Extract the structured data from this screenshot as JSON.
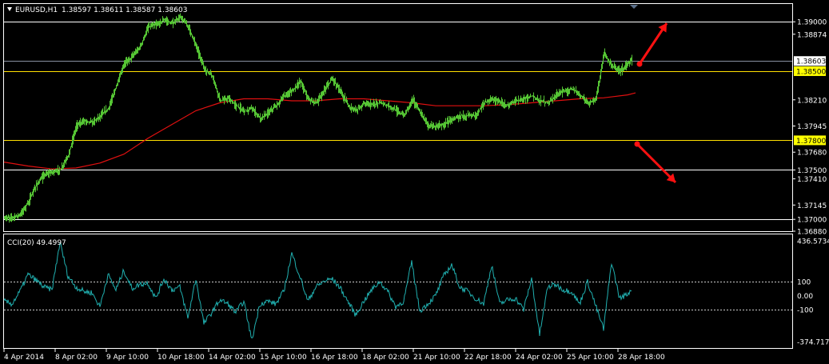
{
  "header": {
    "symbol_label": "EURUSD,H1",
    "ohlc_label": "1.38597 1.38611 1.38587 1.38603",
    "menu_icon": "triangle-down-icon"
  },
  "colors": {
    "background": "#000000",
    "candles": "#55c434",
    "moving_average": "#e01010",
    "cci": "#20b0b0",
    "level_white": "#ffffff",
    "level_yellow": "#ffe000",
    "price_tag_bg": "#ffffff",
    "highlight_tag_bg": "#ffff00",
    "arrows": "#ff1111"
  },
  "chart_data": [
    {
      "type": "line",
      "title": "EURUSD,H1",
      "subtitle": "1.38597 1.38611 1.38587 1.38603",
      "price_axis_ticks": [
        "1.39000",
        "1.38874",
        "1.38603",
        "1.38500",
        "1.38210",
        "1.37945",
        "1.37800",
        "1.37680",
        "1.37500",
        "1.37410",
        "1.37145",
        "1.37000",
        "1.36880"
      ],
      "ylim": [
        1.3688,
        1.3918
      ],
      "levels": [
        {
          "price": 1.39,
          "label": "1.39000",
          "color": "white"
        },
        {
          "price": 1.38603,
          "label": "1.38603",
          "color": "gray"
        },
        {
          "price": 1.385,
          "label": "1.38500",
          "color": "yellow"
        },
        {
          "price": 1.378,
          "label": "1.37800",
          "color": "yellow"
        },
        {
          "price": 1.375,
          "label": "1.37500",
          "color": "white"
        },
        {
          "price": 1.37,
          "label": "1.37000",
          "color": "white"
        }
      ],
      "series": [
        {
          "x": [
            0,
            10,
            20,
            30,
            40,
            50,
            60,
            70,
            80,
            90,
            100,
            110,
            120,
            130,
            140,
            150,
            160,
            170,
            180,
            190,
            200,
            210,
            220,
            230,
            240,
            250,
            260,
            270,
            280,
            290,
            300,
            310,
            320,
            330,
            340,
            350,
            360,
            370,
            380,
            390,
            400,
            410,
            420,
            430,
            440,
            450,
            460,
            470,
            480,
            490,
            500,
            510,
            520,
            530,
            540,
            550,
            560,
            570,
            580,
            590,
            600,
            610,
            620,
            630,
            640,
            650,
            660,
            670,
            680,
            690,
            700,
            710,
            720,
            730,
            740,
            750,
            760,
            770,
            780,
            785
          ],
          "values": [
            1.3701,
            1.3702,
            1.3705,
            1.3718,
            1.3735,
            1.3745,
            1.3748,
            1.375,
            1.3765,
            1.3795,
            1.38,
            1.3798,
            1.3805,
            1.3812,
            1.3835,
            1.3858,
            1.3865,
            1.3875,
            1.3895,
            1.3897,
            1.3902,
            1.3898,
            1.3905,
            1.3895,
            1.3875,
            1.3852,
            1.3845,
            1.382,
            1.3822,
            1.3815,
            1.381,
            1.3812,
            1.3802,
            1.3808,
            1.3815,
            1.3825,
            1.383,
            1.384,
            1.3822,
            1.3818,
            1.383,
            1.3843,
            1.383,
            1.3815,
            1.381,
            1.3818,
            1.3816,
            1.3818,
            1.3815,
            1.381,
            1.3805,
            1.3822,
            1.3808,
            1.3795,
            1.3794,
            1.3796,
            1.3802,
            1.3805,
            1.3805,
            1.3805,
            1.3818,
            1.3822,
            1.3818,
            1.3815,
            1.382,
            1.3822,
            1.3825,
            1.382,
            1.3818,
            1.3826,
            1.383,
            1.3832,
            1.3826,
            1.3818,
            1.3822,
            1.3868,
            1.3855,
            1.385,
            1.3858,
            1.3862
          ]
        },
        {
          "name": "MA",
          "x": [
            0,
            30,
            60,
            90,
            120,
            150,
            180,
            210,
            240,
            270,
            300,
            330,
            360,
            390,
            420,
            450,
            480,
            510,
            540,
            570,
            600,
            630,
            660,
            690,
            720,
            750,
            780,
            790
          ],
          "values": [
            1.3758,
            1.3754,
            1.3751,
            1.3752,
            1.3757,
            1.3766,
            1.3782,
            1.3796,
            1.381,
            1.3818,
            1.3822,
            1.3822,
            1.382,
            1.382,
            1.3822,
            1.3822,
            1.382,
            1.3818,
            1.3815,
            1.3815,
            1.3815,
            1.3816,
            1.3818,
            1.382,
            1.3822,
            1.3823,
            1.3826,
            1.3828
          ]
        }
      ]
    },
    {
      "type": "line",
      "title": "CCI(20) 49.4997",
      "price_axis_ticks": [
        "436.5734",
        "100",
        "0.00",
        "-100",
        "-374.7172"
      ],
      "ylim": [
        -374.7172,
        436.5734
      ],
      "reference_lines": [
        100,
        -100
      ],
      "series": [
        {
          "x": [
            0,
            10,
            20,
            30,
            40,
            50,
            60,
            70,
            80,
            90,
            100,
            110,
            120,
            130,
            140,
            150,
            160,
            170,
            180,
            190,
            200,
            210,
            220,
            230,
            240,
            250,
            260,
            270,
            280,
            290,
            300,
            310,
            320,
            330,
            340,
            350,
            360,
            370,
            380,
            390,
            400,
            410,
            420,
            430,
            440,
            450,
            460,
            470,
            480,
            490,
            500,
            510,
            520,
            530,
            540,
            550,
            560,
            570,
            580,
            590,
            600,
            610,
            620,
            630,
            640,
            650,
            660,
            670,
            680,
            690,
            700,
            710,
            720,
            730,
            740,
            750,
            760,
            770,
            780,
            785
          ],
          "values": [
            -40,
            -60,
            30,
            150,
            110,
            60,
            40,
            380,
            140,
            60,
            30,
            20,
            -80,
            150,
            40,
            180,
            50,
            80,
            90,
            -20,
            120,
            40,
            60,
            -160,
            120,
            -200,
            -120,
            -30,
            -60,
            -120,
            -40,
            -320,
            -60,
            -40,
            -60,
            30,
            300,
            140,
            -40,
            60,
            100,
            120,
            60,
            -40,
            -140,
            -40,
            40,
            100,
            30,
            -80,
            -40,
            240,
            -110,
            -60,
            0,
            140,
            220,
            60,
            30,
            -20,
            -60,
            220,
            -60,
            -30,
            -20,
            -100,
            120,
            -280,
            60,
            80,
            40,
            30,
            -60,
            100,
            -70,
            -240,
            240,
            -20,
            10,
            50
          ]
        }
      ]
    }
  ],
  "time_axis": {
    "labels": [
      "4 Apr 2014",
      "8 Apr 02:00",
      "9 Apr 10:00",
      "10 Apr 18:00",
      "14 Apr 02:00",
      "15 Apr 10:00",
      "16 Apr 18:00",
      "18 Apr 02:00",
      "21 Apr 10:00",
      "22 Apr 18:00",
      "24 Apr 02:00",
      "25 Apr 10:00",
      "28 Apr 18:00"
    ]
  }
}
